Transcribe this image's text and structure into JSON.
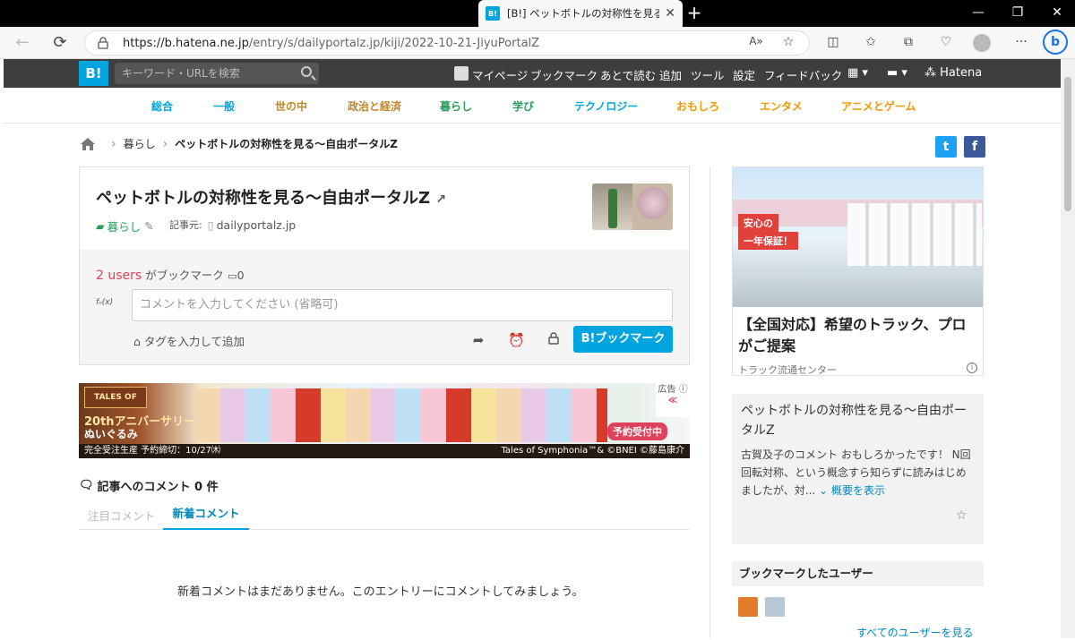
{
  "browser": {
    "tab_title": "[B!] ペットボトルの対称性を見る～自由ポータルZ",
    "tab_favicon": "B!",
    "url_host": "https://b.hatena.ne.jp",
    "url_path": "/entry/s/dailyportalz.jp/kiji/2022-10-21-JiyuPortalZ",
    "bing_label": "b"
  },
  "header": {
    "logo": "B!",
    "search_placeholder": "キーワード・URLを検索",
    "links": [
      "マイページ",
      "ブックマーク",
      "あとで読む",
      "追加",
      "ツール",
      "設定",
      "フィードバック"
    ],
    "brand": "Hatena"
  },
  "categories": [
    {
      "label": "総合",
      "color": "#00a4de"
    },
    {
      "label": "一般",
      "color": "#00a4de"
    },
    {
      "label": "世の中",
      "color": "#c0862a"
    },
    {
      "label": "政治と経済",
      "color": "#c0862a"
    },
    {
      "label": "暮らし",
      "color": "#2a9d5c"
    },
    {
      "label": "学び",
      "color": "#2a9d5c"
    },
    {
      "label": "テクノロジー",
      "color": "#00a4de"
    },
    {
      "label": "おもしろ",
      "color": "#f39800"
    },
    {
      "label": "エンタメ",
      "color": "#f39800"
    },
    {
      "label": "アニメとゲーム",
      "color": "#f39800"
    }
  ],
  "breadcrumb": {
    "category": "暮らし",
    "current": "ペットボトルの対称性を見る～自由ポータルZ"
  },
  "entry": {
    "title": "ペットボトルの対称性を見る～自由ポータルZ",
    "category": "暮らし",
    "source_label": "記事元:",
    "source": "dailyportalz.jp",
    "users_count": "2 users",
    "users_suffix": "がブックマーク",
    "comment_count": "0",
    "avatar_text": "fₙ(x)",
    "comment_placeholder": "コメントを入力してください (省略可)",
    "tag_add": "タグを入力して追加",
    "bookmark_button": "B!ブックマーク"
  },
  "ad": {
    "line1": "20thアニバーサリー",
    "line2": "ぬいぐるみ",
    "footer": "完全受注生産 予約締切：10/27㈭",
    "footer_right": "Tales of Symphonia™& ©BNEI ©藤島康介",
    "badge": "予約受付中",
    "label": "広告"
  },
  "comments": {
    "heading": "記事へのコメント 0 件",
    "tab_featured": "注目コメント",
    "tab_new": "新着コメント",
    "empty_message": "新着コメントはまだありません。このエントリーにコメントしてみましょう。"
  },
  "sidebar": {
    "ad_badge1": "安心の",
    "ad_badge2": "一年保証！",
    "ad_headline": "【全国対応】希望のトラック、プロがご提案",
    "ad_sponsor": "トラック流通センター",
    "summary_title": "ペットボトルの対称性を見る～自由ポータルZ",
    "summary_body": "古賀及子のコメント おもしろかったです！ N回回転対称、という概念すら知らずに読みはじめましたが、対...",
    "summary_more": "概要を表示",
    "bookmark_users_title": "ブックマークしたユーザー",
    "all_users": "すべてのユーザーを見る"
  }
}
